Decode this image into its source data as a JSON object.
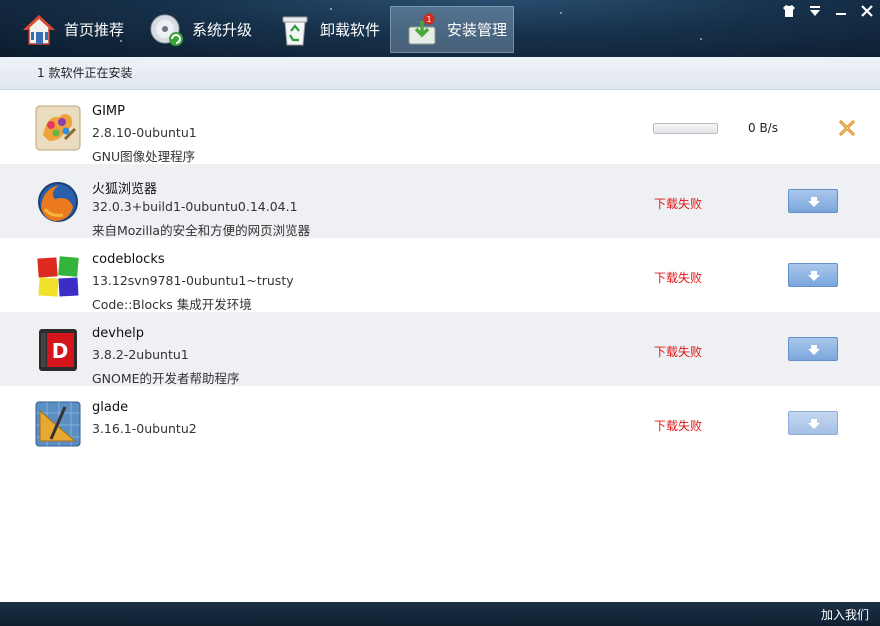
{
  "tabs": [
    {
      "label": "首页推荐",
      "icon": "home-icon"
    },
    {
      "label": "系统升级",
      "icon": "disc-upgrade-icon"
    },
    {
      "label": "卸载软件",
      "icon": "recycle-bin-icon"
    },
    {
      "label": "安装管理",
      "icon": "install-manage-icon",
      "badge": "1",
      "active": true
    }
  ],
  "window_controls": {
    "skin": "shirt-icon",
    "menu": "menu-icon",
    "minimize": "minimize-icon",
    "close": "close-icon"
  },
  "status": {
    "text": "1 款软件正在安装"
  },
  "installing": {
    "name": "GIMP",
    "version": "2.8.10-0ubuntu1",
    "description": "GNU图像处理程序",
    "progress": 0,
    "speed": "0 B/s",
    "icon": "gimp-icon"
  },
  "failed": [
    {
      "name": "火狐浏览器",
      "version": "32.0.3+build1-0ubuntu0.14.04.1",
      "description": "来自Mozilla的安全和方便的网页浏览器",
      "status": "下载失败",
      "icon": "firefox-icon"
    },
    {
      "name": "codeblocks",
      "version": "13.12svn9781-0ubuntu1~trusty",
      "description": "Code::Blocks 集成开发环境",
      "status": "下载失败",
      "icon": "codeblocks-icon"
    },
    {
      "name": "devhelp",
      "version": "3.8.2-2ubuntu1",
      "description": "GNOME的开发者帮助程序",
      "status": "下载失败",
      "icon": "devhelp-icon"
    },
    {
      "name": "glade",
      "version": "3.16.1-0ubuntu2",
      "description": "",
      "status": "下载失败",
      "icon": "glade-icon"
    }
  ],
  "footer": {
    "join_label": "加入我们"
  },
  "colors": {
    "accent": "#7aa6dc",
    "fail": "#e01818",
    "header": "#17324c"
  }
}
